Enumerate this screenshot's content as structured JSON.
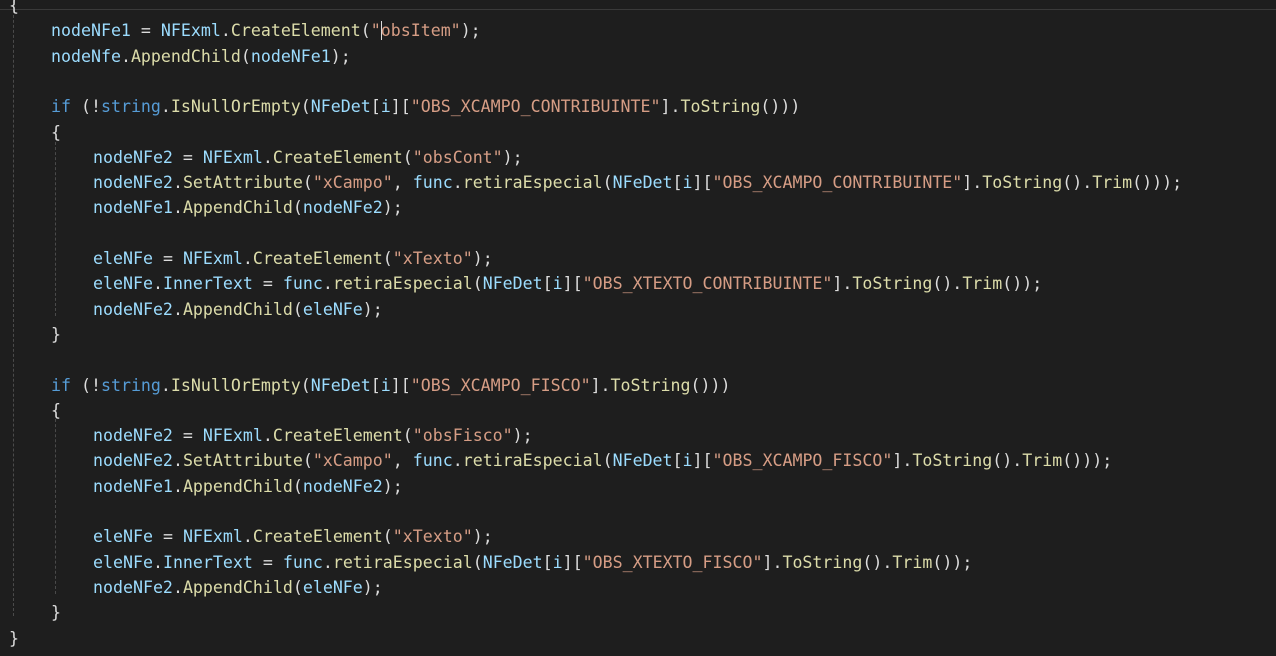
{
  "editor": {
    "lines": [
      {
        "indent": 0,
        "tokens": [
          {
            "t": "{",
            "c": "pl"
          }
        ]
      },
      {
        "indent": 1,
        "tokens": [
          {
            "t": "nodeNFe1",
            "c": "fld"
          },
          {
            "t": " = ",
            "c": "pl"
          },
          {
            "t": "NFExml",
            "c": "fld"
          },
          {
            "t": ".",
            "c": "pl"
          },
          {
            "t": "CreateElement",
            "c": "mth"
          },
          {
            "t": "(",
            "c": "pl"
          },
          {
            "t": "\"",
            "c": "str"
          },
          {
            "caret": true
          },
          {
            "t": "obsItem\"",
            "c": "str"
          },
          {
            "t": ");",
            "c": "pl"
          }
        ]
      },
      {
        "indent": 1,
        "tokens": [
          {
            "t": "nodeNfe",
            "c": "fld"
          },
          {
            "t": ".",
            "c": "pl"
          },
          {
            "t": "AppendChild",
            "c": "mth"
          },
          {
            "t": "(",
            "c": "pl"
          },
          {
            "t": "nodeNFe1",
            "c": "fld"
          },
          {
            "t": ");",
            "c": "pl"
          }
        ]
      },
      {
        "indent": 0,
        "tokens": []
      },
      {
        "indent": 1,
        "tokens": [
          {
            "t": "if",
            "c": "kw"
          },
          {
            "t": " (!",
            "c": "pl"
          },
          {
            "t": "string",
            "c": "kw"
          },
          {
            "t": ".",
            "c": "pl"
          },
          {
            "t": "IsNullOrEmpty",
            "c": "mth"
          },
          {
            "t": "(",
            "c": "pl"
          },
          {
            "t": "NFeDet",
            "c": "fld"
          },
          {
            "t": "[",
            "c": "pl"
          },
          {
            "t": "i",
            "c": "fld"
          },
          {
            "t": "][",
            "c": "pl"
          },
          {
            "t": "\"OBS_XCAMPO_CONTRIBUINTE\"",
            "c": "str"
          },
          {
            "t": "].",
            "c": "pl"
          },
          {
            "t": "ToString",
            "c": "mth"
          },
          {
            "t": "()))",
            "c": "pl"
          }
        ]
      },
      {
        "indent": 1,
        "tokens": [
          {
            "t": "{",
            "c": "pl"
          }
        ]
      },
      {
        "indent": 2,
        "tokens": [
          {
            "t": "nodeNFe2",
            "c": "fld"
          },
          {
            "t": " = ",
            "c": "pl"
          },
          {
            "t": "NFExml",
            "c": "fld"
          },
          {
            "t": ".",
            "c": "pl"
          },
          {
            "t": "CreateElement",
            "c": "mth"
          },
          {
            "t": "(",
            "c": "pl"
          },
          {
            "t": "\"obsCont\"",
            "c": "str"
          },
          {
            "t": ");",
            "c": "pl"
          }
        ]
      },
      {
        "indent": 2,
        "tokens": [
          {
            "t": "nodeNFe2",
            "c": "fld"
          },
          {
            "t": ".",
            "c": "pl"
          },
          {
            "t": "SetAttribute",
            "c": "mth"
          },
          {
            "t": "(",
            "c": "pl"
          },
          {
            "t": "\"xCampo\"",
            "c": "str"
          },
          {
            "t": ", ",
            "c": "pl"
          },
          {
            "t": "func",
            "c": "fld"
          },
          {
            "t": ".",
            "c": "pl"
          },
          {
            "t": "retiraEspecial",
            "c": "mth"
          },
          {
            "t": "(",
            "c": "pl"
          },
          {
            "t": "NFeDet",
            "c": "fld"
          },
          {
            "t": "[",
            "c": "pl"
          },
          {
            "t": "i",
            "c": "fld"
          },
          {
            "t": "][",
            "c": "pl"
          },
          {
            "t": "\"OBS_XCAMPO_CONTRIBUINTE\"",
            "c": "str"
          },
          {
            "t": "].",
            "c": "pl"
          },
          {
            "t": "ToString",
            "c": "mth"
          },
          {
            "t": "().",
            "c": "pl"
          },
          {
            "t": "Trim",
            "c": "mth"
          },
          {
            "t": "()));",
            "c": "pl"
          }
        ]
      },
      {
        "indent": 2,
        "tokens": [
          {
            "t": "nodeNFe1",
            "c": "fld"
          },
          {
            "t": ".",
            "c": "pl"
          },
          {
            "t": "AppendChild",
            "c": "mth"
          },
          {
            "t": "(",
            "c": "pl"
          },
          {
            "t": "nodeNFe2",
            "c": "fld"
          },
          {
            "t": ");",
            "c": "pl"
          }
        ]
      },
      {
        "indent": 0,
        "tokens": []
      },
      {
        "indent": 2,
        "tokens": [
          {
            "t": "eleNFe",
            "c": "fld"
          },
          {
            "t": " = ",
            "c": "pl"
          },
          {
            "t": "NFExml",
            "c": "fld"
          },
          {
            "t": ".",
            "c": "pl"
          },
          {
            "t": "CreateElement",
            "c": "mth"
          },
          {
            "t": "(",
            "c": "pl"
          },
          {
            "t": "\"xTexto\"",
            "c": "str"
          },
          {
            "t": ");",
            "c": "pl"
          }
        ]
      },
      {
        "indent": 2,
        "tokens": [
          {
            "t": "eleNFe",
            "c": "fld"
          },
          {
            "t": ".",
            "c": "pl"
          },
          {
            "t": "InnerText",
            "c": "fld"
          },
          {
            "t": " = ",
            "c": "pl"
          },
          {
            "t": "func",
            "c": "fld"
          },
          {
            "t": ".",
            "c": "pl"
          },
          {
            "t": "retiraEspecial",
            "c": "mth"
          },
          {
            "t": "(",
            "c": "pl"
          },
          {
            "t": "NFeDet",
            "c": "fld"
          },
          {
            "t": "[",
            "c": "pl"
          },
          {
            "t": "i",
            "c": "fld"
          },
          {
            "t": "][",
            "c": "pl"
          },
          {
            "t": "\"OBS_XTEXTO_CONTRIBUINTE\"",
            "c": "str"
          },
          {
            "t": "].",
            "c": "pl"
          },
          {
            "t": "ToString",
            "c": "mth"
          },
          {
            "t": "().",
            "c": "pl"
          },
          {
            "t": "Trim",
            "c": "mth"
          },
          {
            "t": "());",
            "c": "pl"
          }
        ]
      },
      {
        "indent": 2,
        "tokens": [
          {
            "t": "nodeNFe2",
            "c": "fld"
          },
          {
            "t": ".",
            "c": "pl"
          },
          {
            "t": "AppendChild",
            "c": "mth"
          },
          {
            "t": "(",
            "c": "pl"
          },
          {
            "t": "eleNFe",
            "c": "fld"
          },
          {
            "t": ");",
            "c": "pl"
          }
        ]
      },
      {
        "indent": 1,
        "tokens": [
          {
            "t": "}",
            "c": "pl"
          }
        ]
      },
      {
        "indent": 0,
        "tokens": []
      },
      {
        "indent": 1,
        "tokens": [
          {
            "t": "if",
            "c": "kw"
          },
          {
            "t": " (!",
            "c": "pl"
          },
          {
            "t": "string",
            "c": "kw"
          },
          {
            "t": ".",
            "c": "pl"
          },
          {
            "t": "IsNullOrEmpty",
            "c": "mth"
          },
          {
            "t": "(",
            "c": "pl"
          },
          {
            "t": "NFeDet",
            "c": "fld"
          },
          {
            "t": "[",
            "c": "pl"
          },
          {
            "t": "i",
            "c": "fld"
          },
          {
            "t": "][",
            "c": "pl"
          },
          {
            "t": "\"OBS_XCAMPO_FISCO\"",
            "c": "str"
          },
          {
            "t": "].",
            "c": "pl"
          },
          {
            "t": "ToString",
            "c": "mth"
          },
          {
            "t": "()))",
            "c": "pl"
          }
        ]
      },
      {
        "indent": 1,
        "tokens": [
          {
            "t": "{",
            "c": "pl"
          }
        ]
      },
      {
        "indent": 2,
        "tokens": [
          {
            "t": "nodeNFe2",
            "c": "fld"
          },
          {
            "t": " = ",
            "c": "pl"
          },
          {
            "t": "NFExml",
            "c": "fld"
          },
          {
            "t": ".",
            "c": "pl"
          },
          {
            "t": "CreateElement",
            "c": "mth"
          },
          {
            "t": "(",
            "c": "pl"
          },
          {
            "t": "\"obsFisco\"",
            "c": "str"
          },
          {
            "t": ");",
            "c": "pl"
          }
        ]
      },
      {
        "indent": 2,
        "tokens": [
          {
            "t": "nodeNFe2",
            "c": "fld"
          },
          {
            "t": ".",
            "c": "pl"
          },
          {
            "t": "SetAttribute",
            "c": "mth"
          },
          {
            "t": "(",
            "c": "pl"
          },
          {
            "t": "\"xCampo\"",
            "c": "str"
          },
          {
            "t": ", ",
            "c": "pl"
          },
          {
            "t": "func",
            "c": "fld"
          },
          {
            "t": ".",
            "c": "pl"
          },
          {
            "t": "retiraEspecial",
            "c": "mth"
          },
          {
            "t": "(",
            "c": "pl"
          },
          {
            "t": "NFeDet",
            "c": "fld"
          },
          {
            "t": "[",
            "c": "pl"
          },
          {
            "t": "i",
            "c": "fld"
          },
          {
            "t": "][",
            "c": "pl"
          },
          {
            "t": "\"OBS_XCAMPO_FISCO\"",
            "c": "str"
          },
          {
            "t": "].",
            "c": "pl"
          },
          {
            "t": "ToString",
            "c": "mth"
          },
          {
            "t": "().",
            "c": "pl"
          },
          {
            "t": "Trim",
            "c": "mth"
          },
          {
            "t": "()));",
            "c": "pl"
          }
        ]
      },
      {
        "indent": 2,
        "tokens": [
          {
            "t": "nodeNFe1",
            "c": "fld"
          },
          {
            "t": ".",
            "c": "pl"
          },
          {
            "t": "AppendChild",
            "c": "mth"
          },
          {
            "t": "(",
            "c": "pl"
          },
          {
            "t": "nodeNFe2",
            "c": "fld"
          },
          {
            "t": ");",
            "c": "pl"
          }
        ]
      },
      {
        "indent": 0,
        "tokens": []
      },
      {
        "indent": 2,
        "tokens": [
          {
            "t": "eleNFe",
            "c": "fld"
          },
          {
            "t": " = ",
            "c": "pl"
          },
          {
            "t": "NFExml",
            "c": "fld"
          },
          {
            "t": ".",
            "c": "pl"
          },
          {
            "t": "CreateElement",
            "c": "mth"
          },
          {
            "t": "(",
            "c": "pl"
          },
          {
            "t": "\"xTexto\"",
            "c": "str"
          },
          {
            "t": ");",
            "c": "pl"
          }
        ]
      },
      {
        "indent": 2,
        "tokens": [
          {
            "t": "eleNFe",
            "c": "fld"
          },
          {
            "t": ".",
            "c": "pl"
          },
          {
            "t": "InnerText",
            "c": "fld"
          },
          {
            "t": " = ",
            "c": "pl"
          },
          {
            "t": "func",
            "c": "fld"
          },
          {
            "t": ".",
            "c": "pl"
          },
          {
            "t": "retiraEspecial",
            "c": "mth"
          },
          {
            "t": "(",
            "c": "pl"
          },
          {
            "t": "NFeDet",
            "c": "fld"
          },
          {
            "t": "[",
            "c": "pl"
          },
          {
            "t": "i",
            "c": "fld"
          },
          {
            "t": "][",
            "c": "pl"
          },
          {
            "t": "\"OBS_XTEXTO_FISCO\"",
            "c": "str"
          },
          {
            "t": "].",
            "c": "pl"
          },
          {
            "t": "ToString",
            "c": "mth"
          },
          {
            "t": "().",
            "c": "pl"
          },
          {
            "t": "Trim",
            "c": "mth"
          },
          {
            "t": "());",
            "c": "pl"
          }
        ]
      },
      {
        "indent": 2,
        "tokens": [
          {
            "t": "nodeNFe2",
            "c": "fld"
          },
          {
            "t": ".",
            "c": "pl"
          },
          {
            "t": "AppendChild",
            "c": "mth"
          },
          {
            "t": "(",
            "c": "pl"
          },
          {
            "t": "eleNFe",
            "c": "fld"
          },
          {
            "t": ");",
            "c": "pl"
          }
        ]
      },
      {
        "indent": 1,
        "tokens": [
          {
            "t": "}",
            "c": "pl"
          }
        ]
      },
      {
        "indent": 0,
        "tokens": [
          {
            "t": "}",
            "c": "pl"
          }
        ]
      }
    ]
  }
}
